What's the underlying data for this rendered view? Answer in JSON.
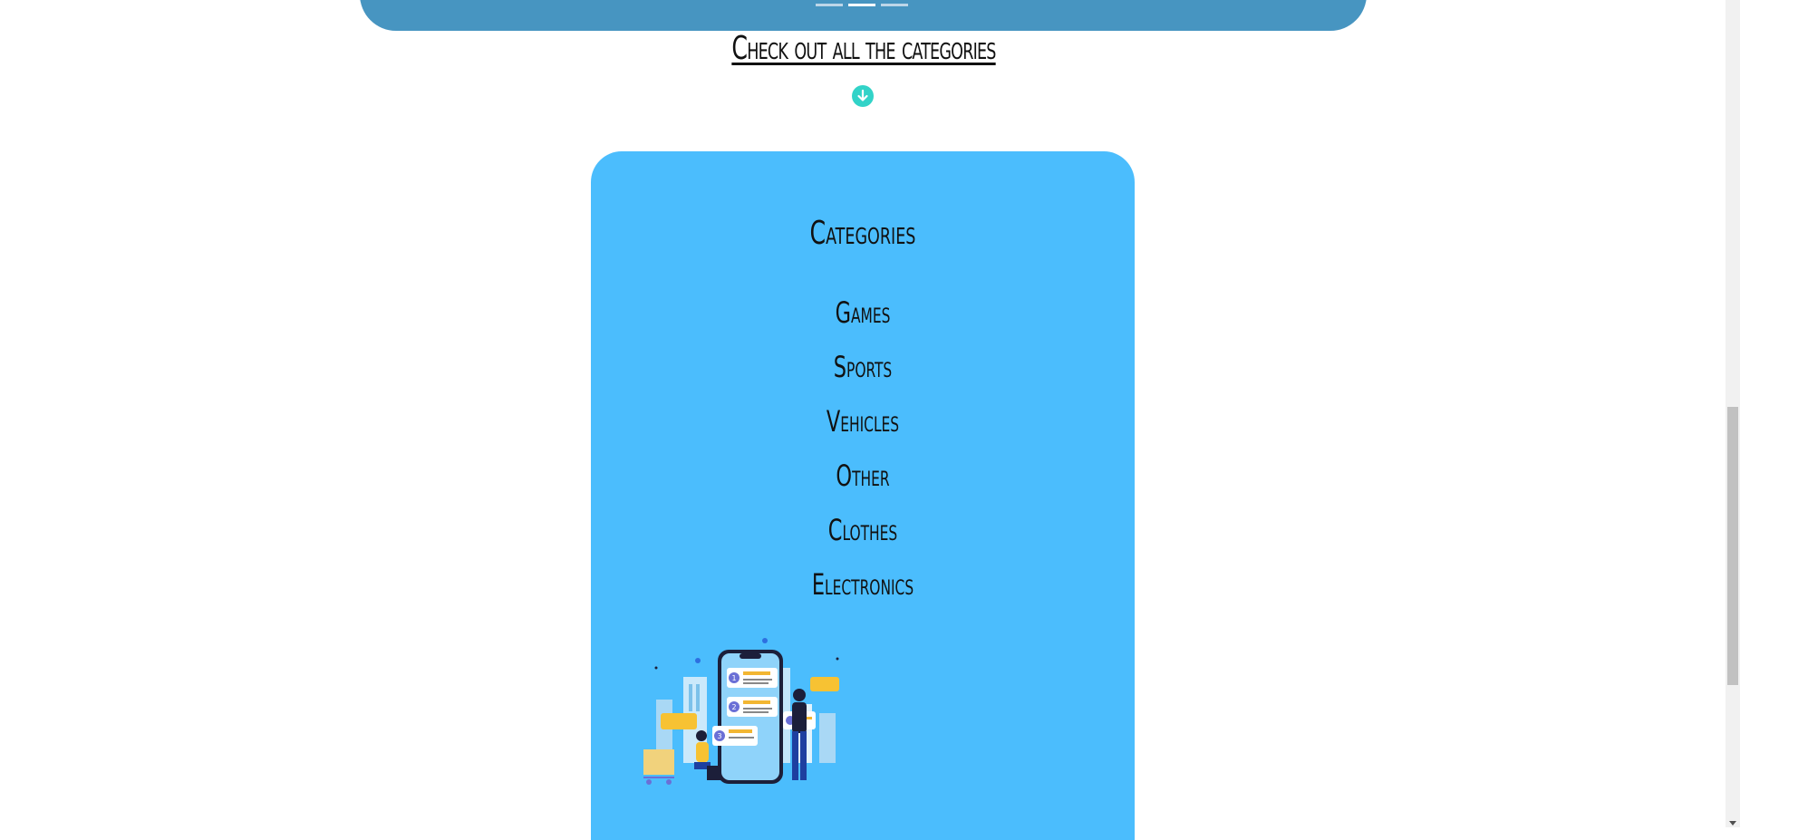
{
  "carousel": {
    "indicators": 3,
    "active_index": 1,
    "color": "#4795c1"
  },
  "headline": "Check out all the categories",
  "down_button": {
    "icon": "arrow-down-circle-icon",
    "color": "#32d3c8"
  },
  "categories_card": {
    "title": "Categories",
    "background": "#4bbdfd",
    "items": [
      "Games",
      "Sports",
      "Vehicles",
      "Other",
      "Clothes",
      "Electronics"
    ],
    "illustration": "product-reviews-illustration"
  },
  "scrollbar": {
    "thumb_position": 0.49
  }
}
